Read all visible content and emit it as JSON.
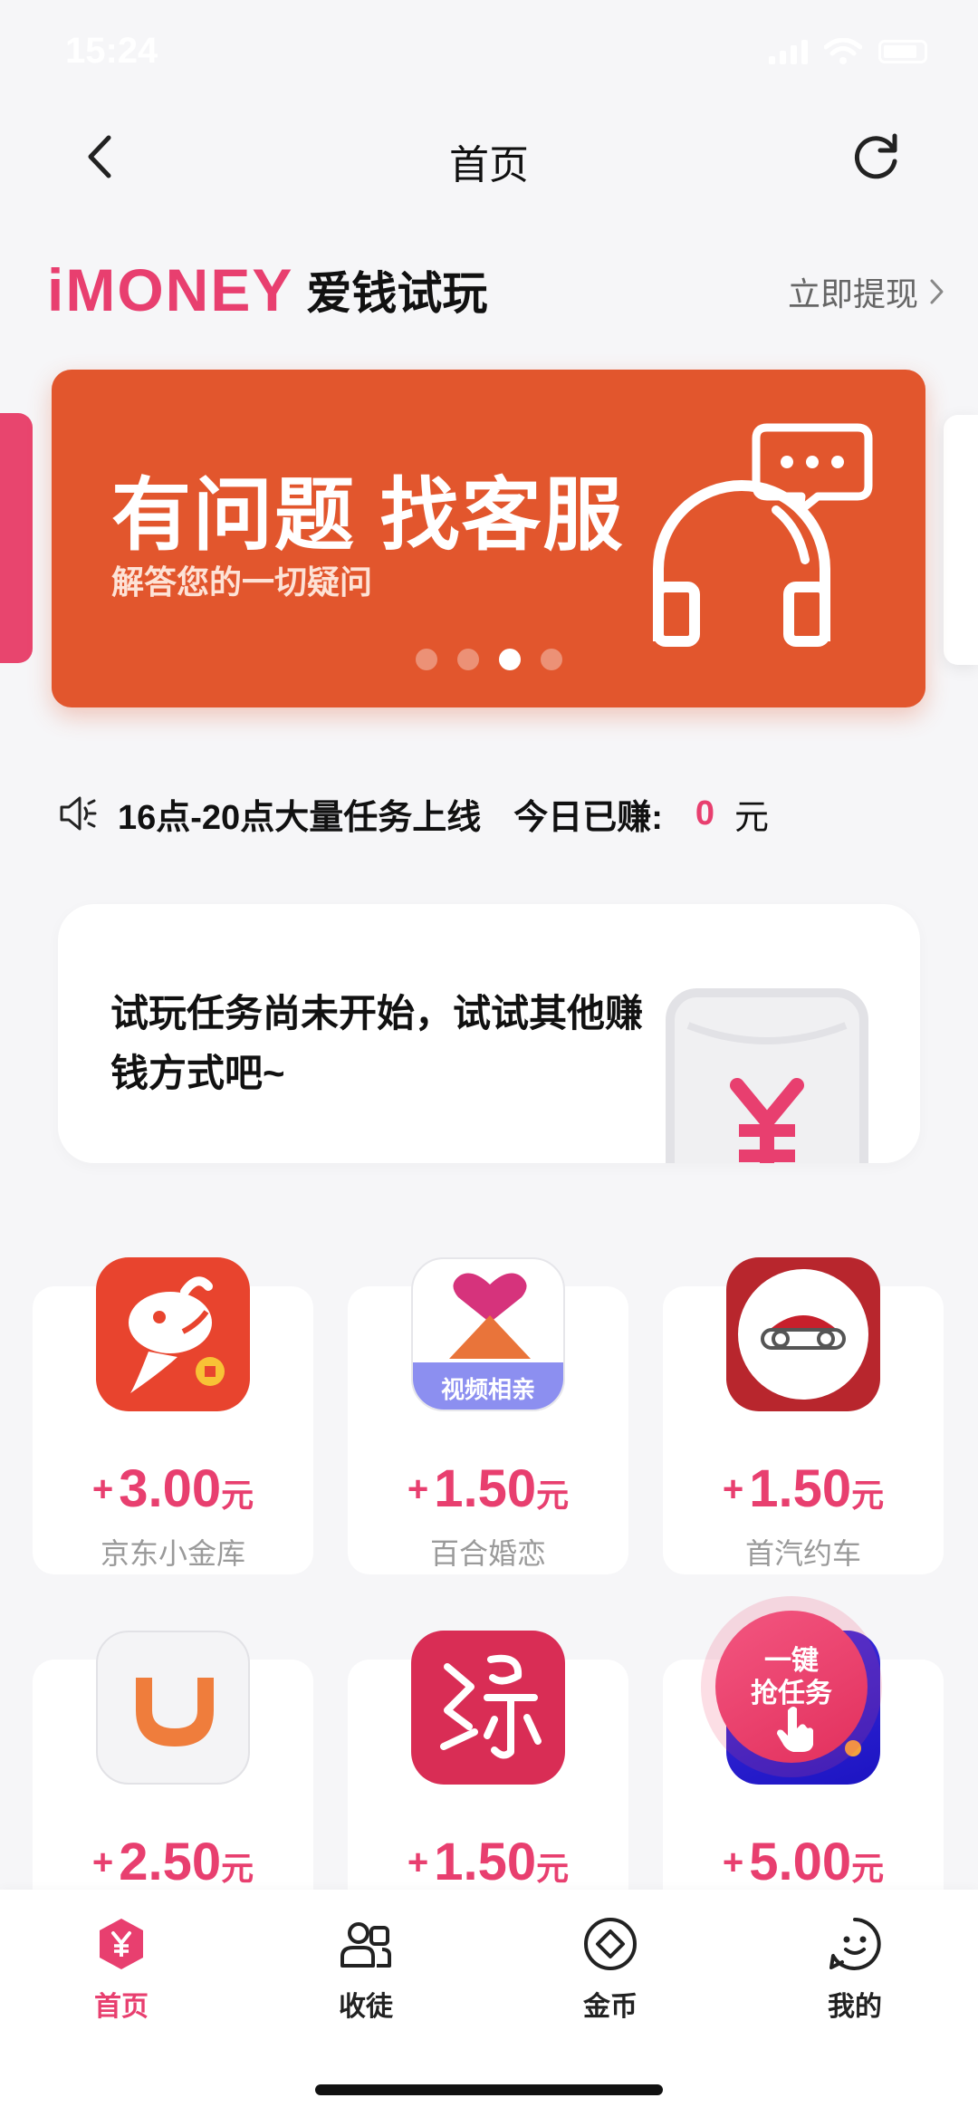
{
  "status_bar": {
    "time": "15:24"
  },
  "nav": {
    "title": "首页"
  },
  "brand": {
    "logo_text": "iMONEY",
    "name": "爱钱试玩",
    "withdraw_label": "立即提现"
  },
  "banner": {
    "title": "有问题 找客服",
    "subtitle": "解答您的一切疑问",
    "dot_count": 4,
    "active_dot": 3,
    "color": "#e2562d"
  },
  "notice": {
    "text": "16点-20点大量任务上线",
    "earned_label": "今日已赚:",
    "earned_amount": "0",
    "earned_unit": "元"
  },
  "task_card": {
    "message": "试玩任务尚未开始，试试其他赚钱方式吧~"
  },
  "apps": [
    {
      "amount": "3.00",
      "unit": "元",
      "name": "京东小金库",
      "icon": "jd-dog-icon"
    },
    {
      "amount": "1.50",
      "unit": "元",
      "name": "百合婚恋",
      "icon": "baihe-heart-icon",
      "icon_caption": "视频相亲"
    },
    {
      "amount": "1.50",
      "unit": "元",
      "name": "首汽约车",
      "icon": "car-icon"
    },
    {
      "amount": "2.50",
      "unit": "元",
      "name": "",
      "icon": "didi-icon"
    },
    {
      "amount": "1.50",
      "unit": "元",
      "name": "",
      "icon": "yuan-icon"
    },
    {
      "amount": "5.00",
      "unit": "元",
      "name": "",
      "icon": "blue-app-icon"
    }
  ],
  "grab_button": {
    "line1": "一键",
    "line2": "抢任务"
  },
  "tabs": [
    {
      "label": "首页",
      "icon": "home-yen-icon",
      "active": true
    },
    {
      "label": "收徒",
      "icon": "people-icon",
      "active": false
    },
    {
      "label": "金币",
      "icon": "coin-icon",
      "active": false
    },
    {
      "label": "我的",
      "icon": "smile-icon",
      "active": false
    }
  ],
  "colors": {
    "accent": "#e83f6f",
    "banner": "#e2562d",
    "background": "#f6f6f8"
  }
}
